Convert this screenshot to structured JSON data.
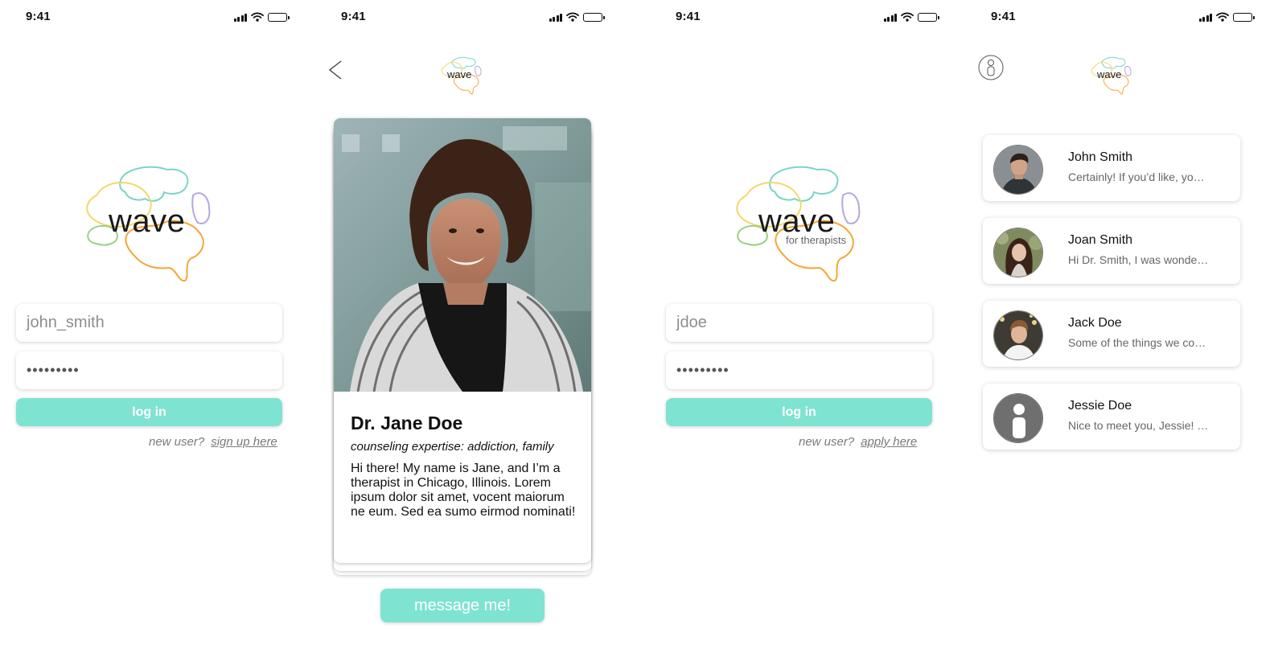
{
  "status_bar": {
    "time": "9:41"
  },
  "screen1": {
    "logo_text": "wave",
    "username_value": "john_smith",
    "password_value": "•••••••••",
    "login_label": "log in",
    "new_user_label": "new user?",
    "signup_link": "sign up here"
  },
  "screen2": {
    "logo_text": "wave",
    "therapist_name": "Dr. Jane Doe",
    "expertise": "counseling expertise: addiction, family",
    "bio": "Hi there! My name is Jane, and I’m a therapist in Chicago, Illinois. Lorem ipsum dolor sit amet, vocent maiorum ne eum. Sed ea sumo eirmod nominati!",
    "message_label": "message me!"
  },
  "screen3": {
    "logo_text": "wave",
    "logo_subtitle": "for therapists",
    "username_value": "jdoe",
    "password_value": "•••••••••",
    "login_label": "log in",
    "new_user_label": "new user?",
    "apply_link": "apply here"
  },
  "screen4": {
    "logo_text": "wave",
    "conversations": [
      {
        "name": "John Smith",
        "preview": "Certainly! If you’d like, you can tell me more"
      },
      {
        "name": "Joan Smith",
        "preview": "Hi Dr. Smith, I was wondering if we could"
      },
      {
        "name": "Jack Doe",
        "preview": "Some of the things we could talk about"
      },
      {
        "name": "Jessie Doe",
        "preview": "Nice to meet you, Jessie! How are you"
      }
    ]
  },
  "icons": {
    "back": "chevron-left-icon",
    "profile": "user-profile-icon",
    "signal": "cellular-signal-icon",
    "wifi": "wifi-icon",
    "battery": "battery-icon"
  },
  "colors": {
    "accent": "#7fe3d1",
    "logo_teal": "#7dd3c8",
    "logo_yellow": "#f3d76a",
    "logo_orange": "#f5a634",
    "logo_green": "#9ccf85",
    "logo_purple": "#b7a6dc",
    "muted_text": "#7a7a7a"
  }
}
